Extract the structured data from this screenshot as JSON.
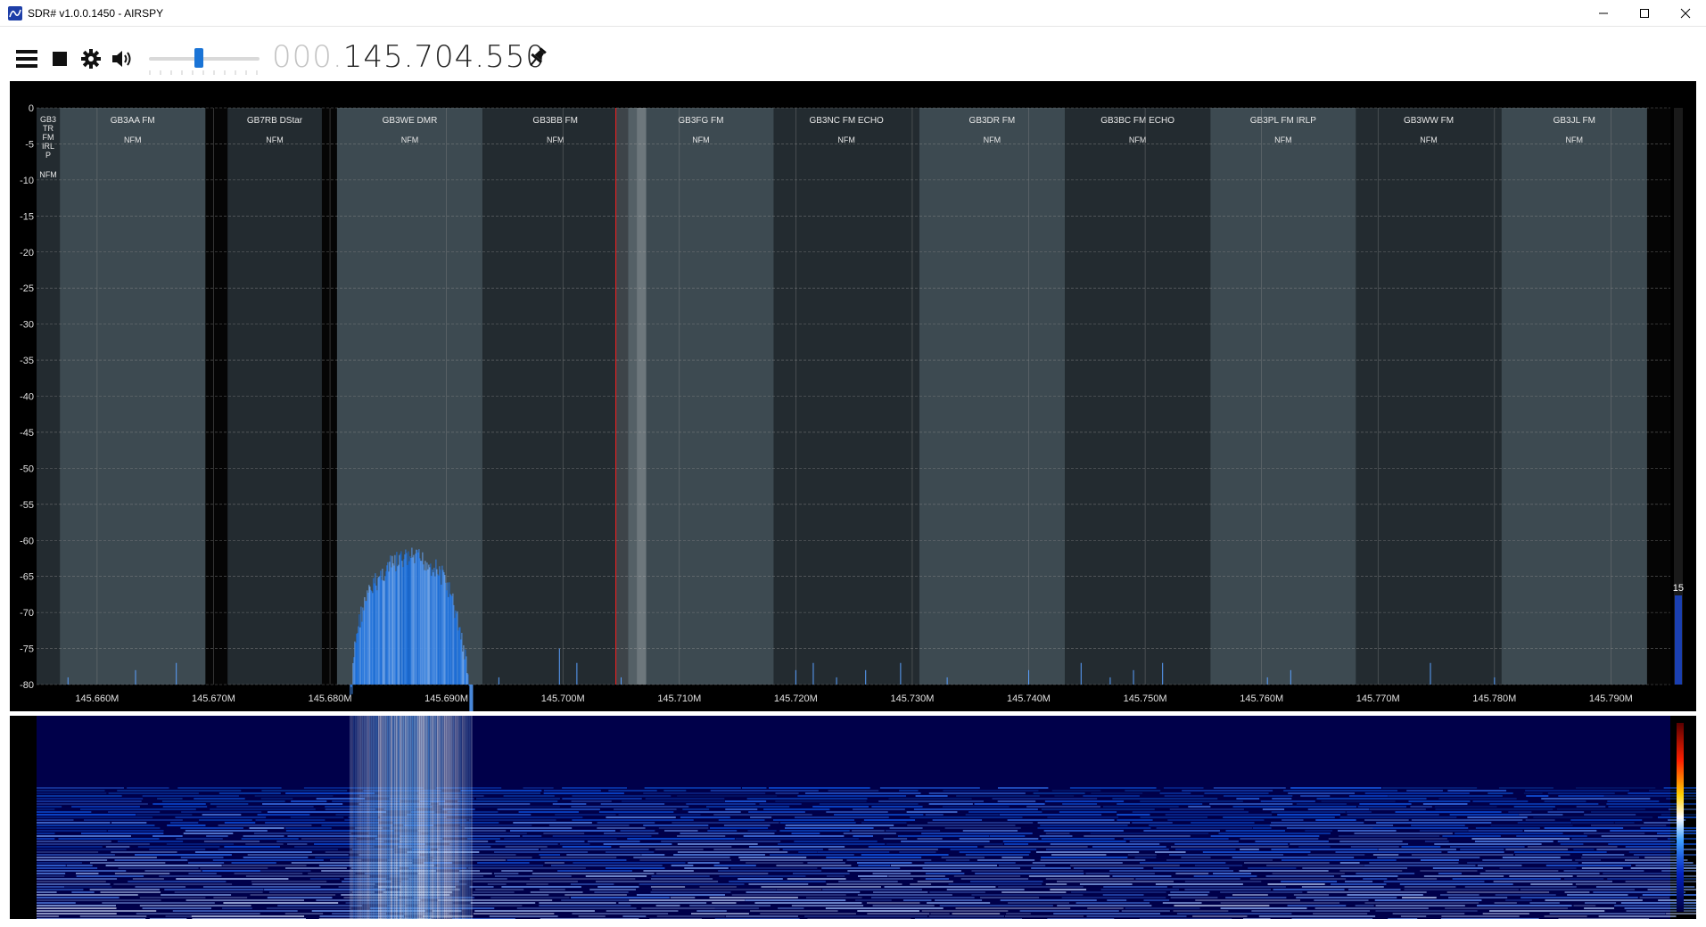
{
  "window": {
    "title": "SDR# v1.0.0.1450 - AIRSPY",
    "controls": [
      "—",
      "☐",
      "✕"
    ]
  },
  "toolbar": {
    "menu_icon": "menu-icon",
    "stop_icon": "stop-icon",
    "settings_icon": "gear-icon",
    "audio_icon": "speaker-icon",
    "volume_level": 0.45,
    "frequency_lead": "000.",
    "frequency_main": "145.704.550",
    "pin_icon": "pin-icon"
  },
  "spectrum": {
    "y_labels": [
      "0",
      "-5",
      "-10",
      "-15",
      "-20",
      "-25",
      "-30",
      "-35",
      "-40",
      "-45",
      "-50",
      "-55",
      "-60",
      "-65",
      "-70",
      "-75",
      "-80"
    ],
    "x_labels": [
      "145.660M",
      "145.670M",
      "145.680M",
      "145.690M",
      "145.700M",
      "145.710M",
      "145.720M",
      "145.730M",
      "145.740M",
      "145.750M",
      "145.760M",
      "145.770M",
      "145.780M",
      "145.790M"
    ],
    "x_label_values": [
      145.66,
      145.67,
      145.68,
      145.69,
      145.7,
      145.71,
      145.72,
      145.73,
      145.74,
      145.75,
      145.76,
      145.77,
      145.78,
      145.79
    ],
    "x_range_mhz": [
      145.6548,
      145.7951
    ],
    "y_range_db": [
      -80,
      0
    ],
    "tuned_mhz": 145.70455,
    "gain_label": "15",
    "bands": [
      {
        "name": "GB3TRFMIRLP",
        "lines": [
          "GB3",
          "TR",
          "FM",
          "IRL",
          "P"
        ],
        "mode": "NFM",
        "start": 145.6548,
        "end": 145.6568,
        "shade": "dark"
      },
      {
        "name": "GB3AA FM",
        "mode": "NFM",
        "start": 145.6568,
        "end": 145.6693,
        "shade": "light"
      },
      {
        "name": "GB7RB DStar",
        "mode": "NFM",
        "start": 145.6712,
        "end": 145.6793,
        "shade": "dark"
      },
      {
        "name": "GB3WE DMR",
        "mode": "NFM",
        "start": 145.6806,
        "end": 145.6931,
        "shade": "light"
      },
      {
        "name": "GB3BB FM",
        "mode": "NFM",
        "start": 145.6931,
        "end": 145.7056,
        "shade": "dark"
      },
      {
        "name": "GB3FG FM",
        "mode": "NFM",
        "start": 145.7056,
        "end": 145.7181,
        "shade": "light"
      },
      {
        "name": "GB3NC FM ECHO",
        "mode": "NFM",
        "start": 145.7181,
        "end": 145.7306,
        "shade": "dark"
      },
      {
        "name": "GB3DR FM",
        "mode": "NFM",
        "start": 145.7306,
        "end": 145.7431,
        "shade": "light"
      },
      {
        "name": "GB3BC FM ECHO",
        "mode": "NFM",
        "start": 145.7431,
        "end": 145.7556,
        "shade": "dark"
      },
      {
        "name": "GB3PL FM IRLP",
        "mode": "NFM",
        "start": 145.7556,
        "end": 145.7681,
        "shade": "light"
      },
      {
        "name": "GB3WW FM",
        "mode": "NFM",
        "start": 145.7681,
        "end": 145.7806,
        "shade": "dark"
      },
      {
        "name": "GB3JL FM",
        "mode": "NFM",
        "start": 145.7806,
        "end": 145.7931,
        "shade": "light"
      }
    ],
    "signal": {
      "center_mhz": 145.687,
      "peak_db": -61,
      "width_mhz": 0.0105,
      "floor_db": -80
    }
  },
  "colors": {
    "band_light": "#3d4a51",
    "band_dark": "#232b30",
    "tuned_line": "#ff2020",
    "signal_fill": "#3b82e6",
    "waterfall_bg": "#00004a"
  }
}
